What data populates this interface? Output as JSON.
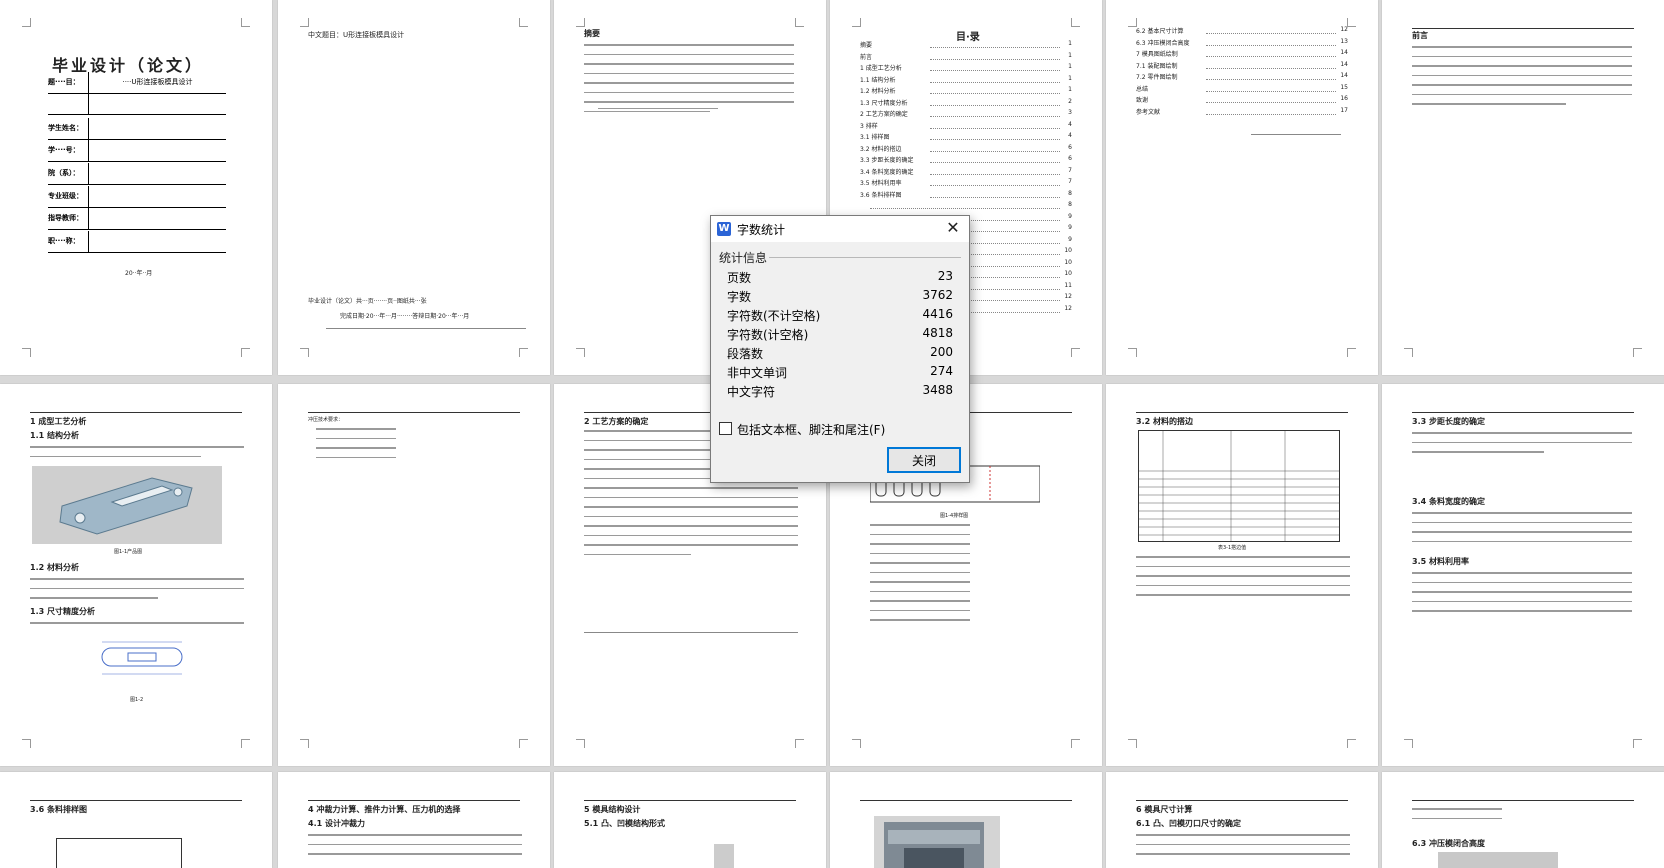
{
  "cover": {
    "title": "毕业设计（论文）",
    "topic_label": "题····目：",
    "topic_value": "····U形连接板模具设计",
    "rows": [
      {
        "label": "学生姓名：",
        "value": ""
      },
      {
        "label": "学····号：",
        "value": ""
      },
      {
        "label": "院（系）：",
        "value": ""
      },
      {
        "label": "专业班级：",
        "value": ""
      },
      {
        "label": "指导教师：",
        "value": ""
      },
      {
        "label": "职····称：",
        "value": ""
      }
    ],
    "date": "20··年··月"
  },
  "page2": {
    "title": "中文题目：U形连接板模具设计",
    "footer1": "毕业设计（论文）共···页·······页··图纸共···张",
    "footer2": "完成日期·20···年···月········答辩日期·20···年···月"
  },
  "page3": {
    "title": "摘要"
  },
  "toc": {
    "title": "目·录",
    "items": [
      {
        "label": "摘要",
        "page": "1"
      },
      {
        "label": "前言",
        "page": "1"
      },
      {
        "label": "1 成型工艺分析",
        "page": "1"
      },
      {
        "label": "1.1 结构分析",
        "page": "1"
      },
      {
        "label": "1.2 材料分析",
        "page": "1"
      },
      {
        "label": "1.3 尺寸精度分析",
        "page": "2"
      },
      {
        "label": "2 工艺方案的确定",
        "page": "3"
      },
      {
        "label": "3 排样",
        "page": "4"
      },
      {
        "label": "3.1 排样图",
        "page": "4"
      },
      {
        "label": "3.2 材料的搭边",
        "page": "6"
      },
      {
        "label": "3.3 步距长度的确定",
        "page": "6"
      },
      {
        "label": "3.4 条料宽度的确定",
        "page": "7"
      },
      {
        "label": "3.5 材料利用率",
        "page": "7"
      },
      {
        "label": "3.6 条料排样图",
        "page": "8"
      },
      {
        "label": "",
        "page": "8"
      },
      {
        "label": "",
        "page": "9"
      },
      {
        "label": "",
        "page": "9"
      },
      {
        "label": "",
        "page": "9"
      },
      {
        "label": "",
        "page": "10"
      },
      {
        "label": "",
        "page": "10"
      },
      {
        "label": "",
        "page": "10"
      },
      {
        "label": "",
        "page": "11"
      },
      {
        "label": "",
        "page": "12"
      },
      {
        "label": "",
        "page": "12"
      }
    ]
  },
  "toc2": {
    "items": [
      {
        "label": "6.2 基本尺寸计算",
        "page": "12"
      },
      {
        "label": "6.3 冲压模闭合高度",
        "page": "13"
      },
      {
        "label": "7 模具图纸绘制",
        "page": "14"
      },
      {
        "label": "7.1 装配图绘制",
        "page": "14"
      },
      {
        "label": "7.2 零件图绘制",
        "page": "14"
      },
      {
        "label": "总结",
        "page": "15"
      },
      {
        "label": "致谢",
        "page": "16"
      },
      {
        "label": "参考文献",
        "page": "17"
      }
    ]
  },
  "page6": {
    "title": "前言"
  },
  "page7": {
    "title": "1 成型工艺分析",
    "sub1": "1.1 结构分析",
    "caption": "图1-1产品图",
    "sub2": "1.2 材料分析",
    "sub3": "1.3 尺寸精度分析",
    "caption2": "图1-2"
  },
  "page8": {
    "title": "冲压技术要求："
  },
  "page9": {
    "title": "2 工艺方案的确定"
  },
  "page10": {
    "caption": "图1-4排样图"
  },
  "page11": {
    "title": "3.2 材料的搭边",
    "caption": "表3-1搭边值"
  },
  "page12": {
    "title": "3.3 步距长度的确定",
    "sub1": "3.4 条料宽度的确定",
    "sub2": "3.5 材料利用率"
  },
  "row3": {
    "p1": "3.6 条料排样图",
    "p2": "4 冲裁力计算、推件力计算、压力机的选择",
    "p2sub": "4.1 设计冲裁力",
    "p3": "5 模具结构设计",
    "p3sub": "5.1 凸、凹模结构形式",
    "p5": "6 模具尺寸计算",
    "p5sub": "6.1 凸、凹模刃口尺寸的确定",
    "p6sub": "6.3 冲压模闭合高度"
  },
  "dialog": {
    "title": "字数统计",
    "icon_letter": "W",
    "group": "统计信息",
    "stats": [
      {
        "label": "页数",
        "value": "23"
      },
      {
        "label": "字数",
        "value": "3762"
      },
      {
        "label": "字符数(不计空格)",
        "value": "4416"
      },
      {
        "label": "字符数(计空格)",
        "value": "4818"
      },
      {
        "label": "段落数",
        "value": "200"
      },
      {
        "label": "非中文单词",
        "value": "274"
      },
      {
        "label": "中文字符",
        "value": "3488"
      }
    ],
    "checkbox_label": "包括文本框、脚注和尾注(F)",
    "close_label": "关闭"
  }
}
